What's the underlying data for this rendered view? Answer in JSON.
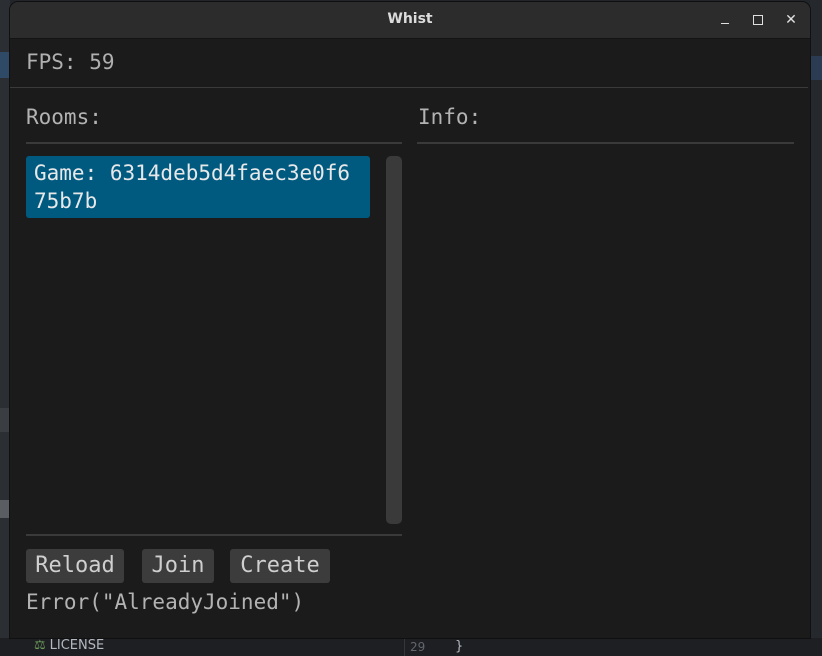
{
  "window": {
    "title": "Whist"
  },
  "titlebar": {
    "minimize_glyph": "",
    "maximize_glyph": "",
    "close_glyph": "✕"
  },
  "status": {
    "fps_label": "FPS:",
    "fps_value": "59"
  },
  "rooms": {
    "heading": "Rooms:",
    "items": [
      {
        "label": "Game: 6314deb5d4faec3e0f675b7b"
      }
    ]
  },
  "info": {
    "heading": "Info:"
  },
  "actions": {
    "reload_label": "Reload",
    "join_label": "Join",
    "create_label": "Create"
  },
  "error_text": "Error(\"AlreadyJoined\")",
  "background": {
    "file_label": "LICENSE",
    "line_number": "29",
    "code_fragment": "}"
  },
  "colors": {
    "selected_room": "#005a80",
    "window_bg": "#1b1b1b",
    "titlebar_bg": "#2c2c2c",
    "button_bg": "#3c3c3c"
  },
  "icons": {
    "license_icon": "scales-icon",
    "minimize": "minimize-icon",
    "maximize": "maximize-icon",
    "close": "close-icon"
  }
}
